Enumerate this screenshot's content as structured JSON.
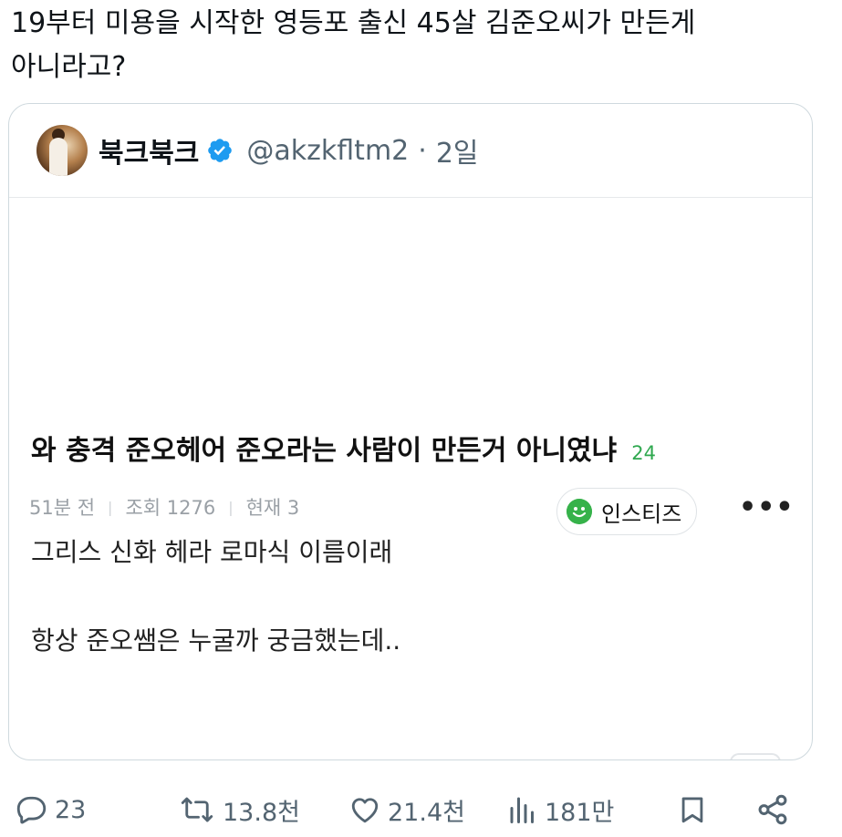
{
  "tweet": {
    "text": "19부터 미용을 시작한 영등포 출신 45살 김준오씨가 만든게\n아니라고?"
  },
  "quote": {
    "author_name": "북크북크",
    "handle": "@akzkfltm2",
    "separator": "·",
    "time": "2일",
    "verified_icon": "verified-badge-icon",
    "post": {
      "title": "와 충격 준오헤어 준오라는 사람이 만든거 아니였냐",
      "comment_count": "24",
      "meta_time": "51분 전",
      "meta_views": "조회 1276",
      "meta_now": "현재 3",
      "board": "인스티즈",
      "more": "•••",
      "body_lines": [
        "그리스 신화 헤라 로마식 이름이래",
        "항상 준오쌤은 누굴까 궁금했는데.."
      ]
    }
  },
  "actions": {
    "reply_count": "23",
    "retweet_count": "13.8천",
    "like_count": "21.4천",
    "view_count": "181만"
  },
  "colors": {
    "text_primary": "#0f1419",
    "text_secondary": "#536471",
    "verified_blue": "#1d9bf0",
    "count_green": "#2fa84f",
    "board_green": "#36b24a",
    "border": "#cfd9de"
  }
}
